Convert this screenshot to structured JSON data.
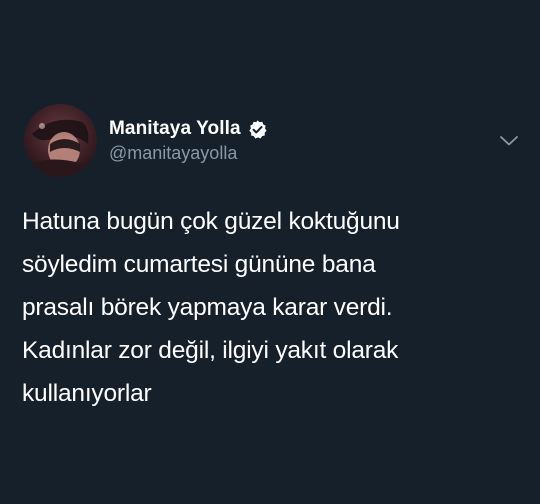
{
  "tweet": {
    "author": {
      "display_name": "Manitaya Yolla",
      "handle": "@manitayayolla",
      "verified": true,
      "avatar_icon": "profile-photo"
    },
    "menu_icon": "chevron-down-icon",
    "lines": [
      "Hatuna bugün çok güzel koktuğunu",
      "söyledim cumartesi gününe bana",
      "prasalı börek yapmaya karar verdi.",
      "Kadınlar zor değil, ilgiyi yakıt olarak",
      "kullanıyorlar"
    ]
  },
  "colors": {
    "background": "#16202b",
    "text_primary": "#ffffff",
    "text_secondary": "#8899a6"
  }
}
